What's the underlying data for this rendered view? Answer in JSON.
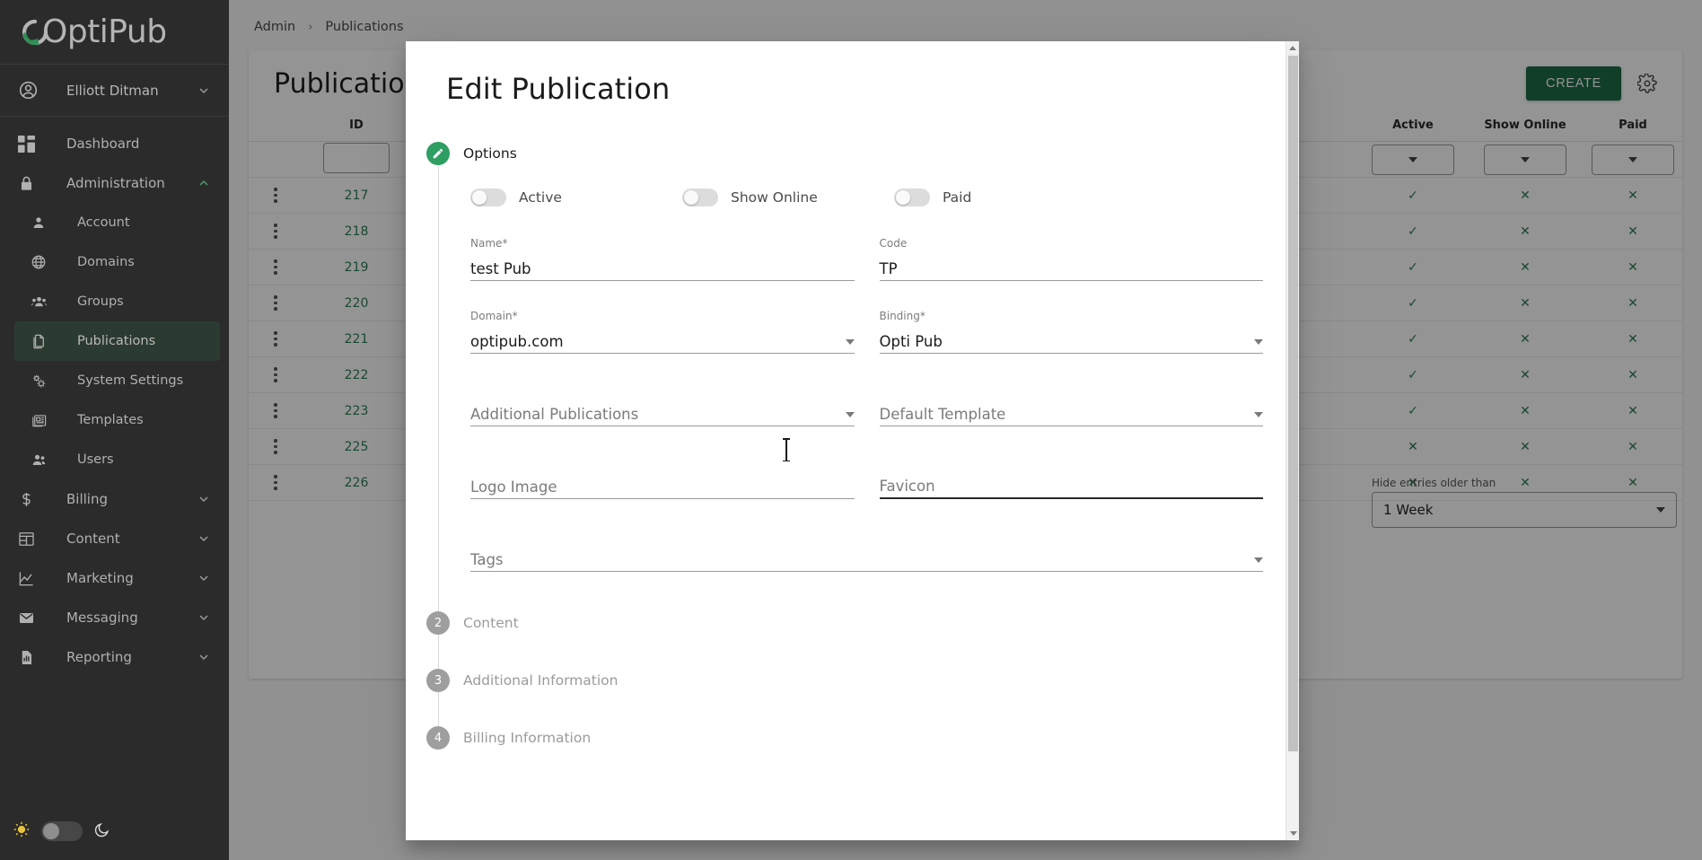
{
  "brand": {
    "name": "OptiPub"
  },
  "sidebar": {
    "user": {
      "name": "Elliott Ditman",
      "icon": "account-circle-icon",
      "chevron": "chevron-down-icon"
    },
    "items": [
      {
        "label": "Dashboard",
        "icon": "dashboard-icon",
        "level": "top",
        "state": "none"
      },
      {
        "label": "Administration",
        "icon": "lock-icon",
        "level": "top",
        "state": "expanded",
        "chevron": "chevron-up-icon"
      },
      {
        "label": "Account",
        "icon": "person-icon",
        "level": "sub",
        "state": "none"
      },
      {
        "label": "Domains",
        "icon": "globe-icon",
        "level": "sub",
        "state": "none"
      },
      {
        "label": "Groups",
        "icon": "group-icon",
        "level": "sub",
        "state": "none"
      },
      {
        "label": "Publications",
        "icon": "pages-icon",
        "level": "sub",
        "state": "active"
      },
      {
        "label": "System Settings",
        "icon": "gears-icon",
        "level": "sub",
        "state": "none"
      },
      {
        "label": "Templates",
        "icon": "template-icon",
        "level": "sub",
        "state": "none"
      },
      {
        "label": "Users",
        "icon": "users-icon",
        "level": "sub",
        "state": "none"
      },
      {
        "label": "Billing",
        "icon": "dollar-icon",
        "level": "top",
        "state": "collapsed",
        "chevron": "chevron-down-icon"
      },
      {
        "label": "Content",
        "icon": "content-layout-icon",
        "level": "top",
        "state": "collapsed",
        "chevron": "chevron-down-icon"
      },
      {
        "label": "Marketing",
        "icon": "chart-line-icon",
        "level": "top",
        "state": "collapsed",
        "chevron": "chevron-down-icon"
      },
      {
        "label": "Messaging",
        "icon": "envelope-icon",
        "level": "top",
        "state": "collapsed",
        "chevron": "chevron-down-icon"
      },
      {
        "label": "Reporting",
        "icon": "report-chart-icon",
        "level": "top",
        "state": "collapsed",
        "chevron": "chevron-down-icon"
      }
    ],
    "theme_toggle": {
      "light_icon": "sun-icon",
      "dark_icon": "moon-icon",
      "state": "light"
    }
  },
  "breadcrumb": {
    "root": "Admin",
    "separator": "›",
    "current": "Publications"
  },
  "page": {
    "title": "Publications",
    "create_label": "CREATE",
    "settings_icon": "gear-icon",
    "table": {
      "columns": [
        "",
        "ID",
        "Active",
        "Show Online",
        "Paid"
      ],
      "rows": [
        {
          "id": "217",
          "active": "✓",
          "show_online": "✕",
          "paid": "✕"
        },
        {
          "id": "218",
          "active": "✓",
          "show_online": "✕",
          "paid": "✕"
        },
        {
          "id": "219",
          "active": "✓",
          "show_online": "✕",
          "paid": "✕"
        },
        {
          "id": "220",
          "active": "✓",
          "show_online": "✕",
          "paid": "✕"
        },
        {
          "id": "221",
          "active": "✓",
          "show_online": "✕",
          "paid": "✕"
        },
        {
          "id": "222",
          "active": "✓",
          "show_online": "✕",
          "paid": "✕"
        },
        {
          "id": "223",
          "active": "✓",
          "show_online": "✕",
          "paid": "✕"
        },
        {
          "id": "225",
          "active": "✕",
          "show_online": "✕",
          "paid": "✕"
        },
        {
          "id": "226",
          "active": "✕",
          "show_online": "✕",
          "paid": "✕"
        }
      ]
    },
    "hide_older": {
      "label": "Hide entries older than",
      "value": "1 Week"
    }
  },
  "modal": {
    "title": "Edit Publication",
    "steps": [
      {
        "num": "1",
        "label": "Options",
        "state": "current",
        "icon": "pencil-icon"
      },
      {
        "num": "2",
        "label": "Content",
        "state": "pending"
      },
      {
        "num": "3",
        "label": "Additional Information",
        "state": "pending"
      },
      {
        "num": "4",
        "label": "Billing Information",
        "state": "pending"
      }
    ],
    "toggles": [
      {
        "label": "Active",
        "on": false
      },
      {
        "label": "Show Online",
        "on": false
      },
      {
        "label": "Paid",
        "on": false
      }
    ],
    "fields": {
      "name": {
        "label": "Name*",
        "value": "test Pub",
        "type": "text"
      },
      "code": {
        "label": "Code",
        "value": "TP",
        "type": "text"
      },
      "domain": {
        "label": "Domain*",
        "value": "optipub.com",
        "type": "select"
      },
      "binding": {
        "label": "Binding*",
        "value": "Opti Pub",
        "type": "select"
      },
      "additional_publications": {
        "label": "",
        "placeholder": "Additional Publications",
        "value": "",
        "type": "select"
      },
      "default_template": {
        "label": "",
        "placeholder": "Default Template",
        "value": "",
        "type": "select"
      },
      "logo_image": {
        "label": "",
        "placeholder": "Logo Image",
        "value": "",
        "type": "text"
      },
      "favicon": {
        "label": "",
        "placeholder": "Favicon",
        "value": "",
        "type": "text",
        "focused": true
      },
      "tags": {
        "label": "",
        "placeholder": "Tags",
        "value": "",
        "type": "select"
      }
    }
  },
  "colors": {
    "brand_green": "#1d6b45",
    "accent_green": "#2f9e63",
    "sidebar_bg": "#2b2b2b",
    "active_nav_bg": "#2c3b31",
    "check_green": "#1b9a4b",
    "cross_red": "#d93025",
    "id_link": "#2e7d52"
  }
}
